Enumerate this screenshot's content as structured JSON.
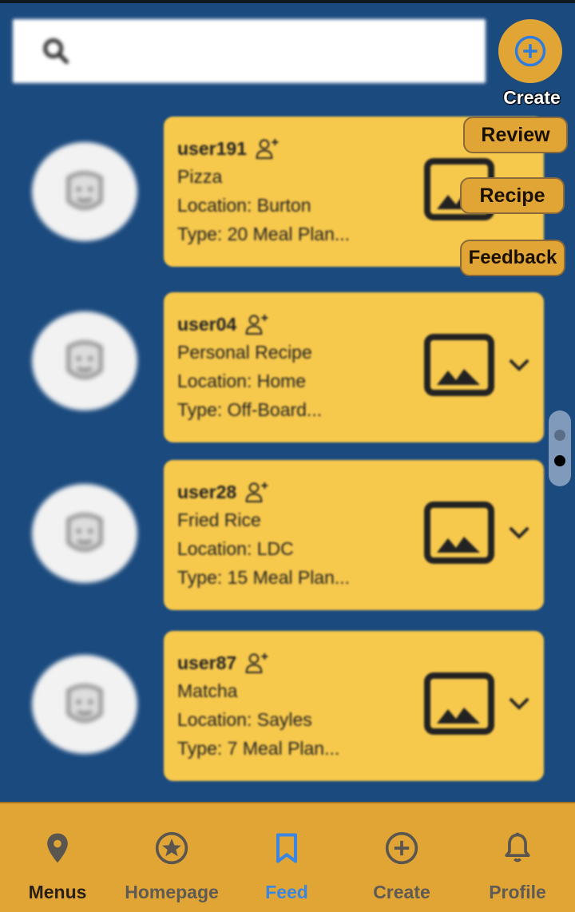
{
  "search": {
    "placeholder": "",
    "icon": "search-icon"
  },
  "create_fab": {
    "label": "Create",
    "icon": "plus-circle-icon"
  },
  "actions": {
    "review": "Review",
    "recipe": "Recipe",
    "feedback": "Feedback"
  },
  "feed": [
    {
      "username": "user191",
      "dish": "Pizza",
      "location": "Location: Burton",
      "type": "Type: 20 Meal Plan..."
    },
    {
      "username": "user04",
      "dish": "Personal Recipe",
      "location": "Location: Home",
      "type": "Type: Off-Board..."
    },
    {
      "username": "user28",
      "dish": "Fried Rice",
      "location": "Location: LDC",
      "type": "Type: 15 Meal Plan..."
    },
    {
      "username": "user87",
      "dish": "Matcha",
      "location": "Location: Sayles",
      "type": "Type: 7 Meal Plan..."
    }
  ],
  "bottom_nav": [
    {
      "label": "Menus",
      "icon": "map-pin-icon"
    },
    {
      "label": "Homepage",
      "icon": "star-circle-icon"
    },
    {
      "label": "Feed",
      "icon": "bookmark-icon",
      "active": true
    },
    {
      "label": "Create",
      "icon": "plus-circle-icon"
    },
    {
      "label": "Profile",
      "icon": "bell-icon"
    }
  ],
  "colors": {
    "background": "#1b4a7e",
    "card": "#f6c84c",
    "accent": "#e0a535",
    "active_nav": "#3a86e0"
  }
}
